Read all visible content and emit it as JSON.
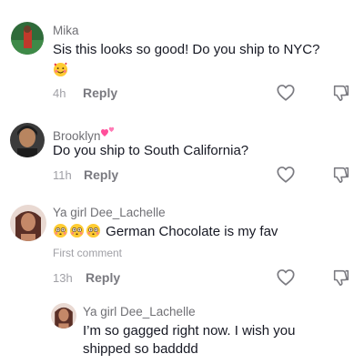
{
  "comments": [
    {
      "username": "Mika",
      "text": "Sis this looks so good! Do you ship to NYC?",
      "emoji": "smiling-face-with-hearts",
      "time": "4h",
      "reply_label": "Reply"
    },
    {
      "username": "Brooklyn",
      "username_emoji": "pink-hearts",
      "text": "Do you ship to South California?",
      "time": "11h",
      "reply_label": "Reply"
    },
    {
      "username": "Ya girl Dee_Lachelle",
      "emoji": "flushed-face",
      "text": "German Chocolate is my fav",
      "subtitle": "First comment",
      "time": "13h",
      "reply_label": "Reply"
    }
  ],
  "reply": {
    "username": "Ya girl Dee_Lachelle",
    "line1": "I’m so gagged right now. I wish you",
    "line2": "shipped so badddd"
  },
  "icons": {
    "like": "heart-outline-icon",
    "dislike": "thumbs-down-outline-icon"
  },
  "colors": {
    "text": "#161823",
    "username": "#6f6f74",
    "meta": "#a0a0a6",
    "heart_emoji": "#ff3b8a"
  }
}
